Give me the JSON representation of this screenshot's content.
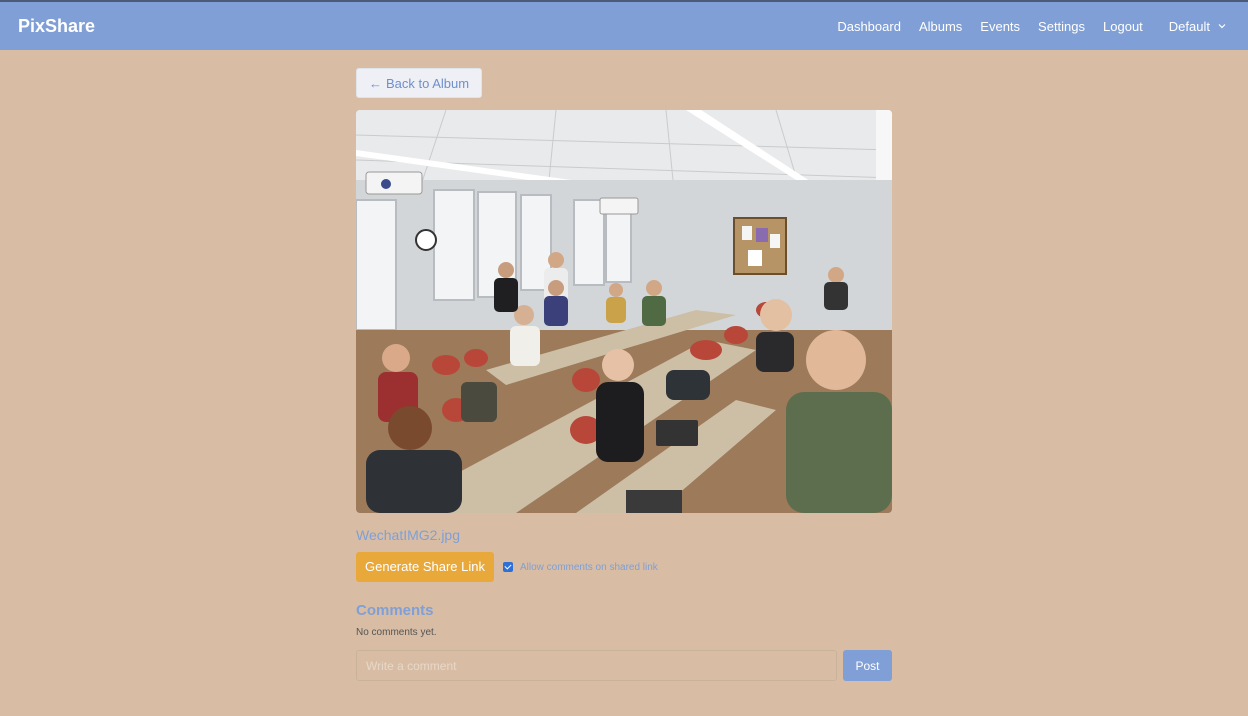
{
  "navbar": {
    "brand": "PixShare",
    "links": [
      "Dashboard",
      "Albums",
      "Events",
      "Settings",
      "Logout"
    ],
    "dropdown_value": "Default"
  },
  "photo_view": {
    "back_label": "Back to Album",
    "filename": "WechatIMG2.jpg",
    "share_button": "Generate Share Link",
    "allow_comments_label": "Allow comments on shared link",
    "allow_comments_checked": true
  },
  "comments": {
    "title": "Comments",
    "empty_text": "No comments yet.",
    "input_placeholder": "Write a comment",
    "post_label": "Post"
  },
  "colors": {
    "background": "#d8bda4",
    "navbar": "#7f9fd6",
    "accent": "#7f9fd6",
    "share_button": "#e9a83a"
  }
}
